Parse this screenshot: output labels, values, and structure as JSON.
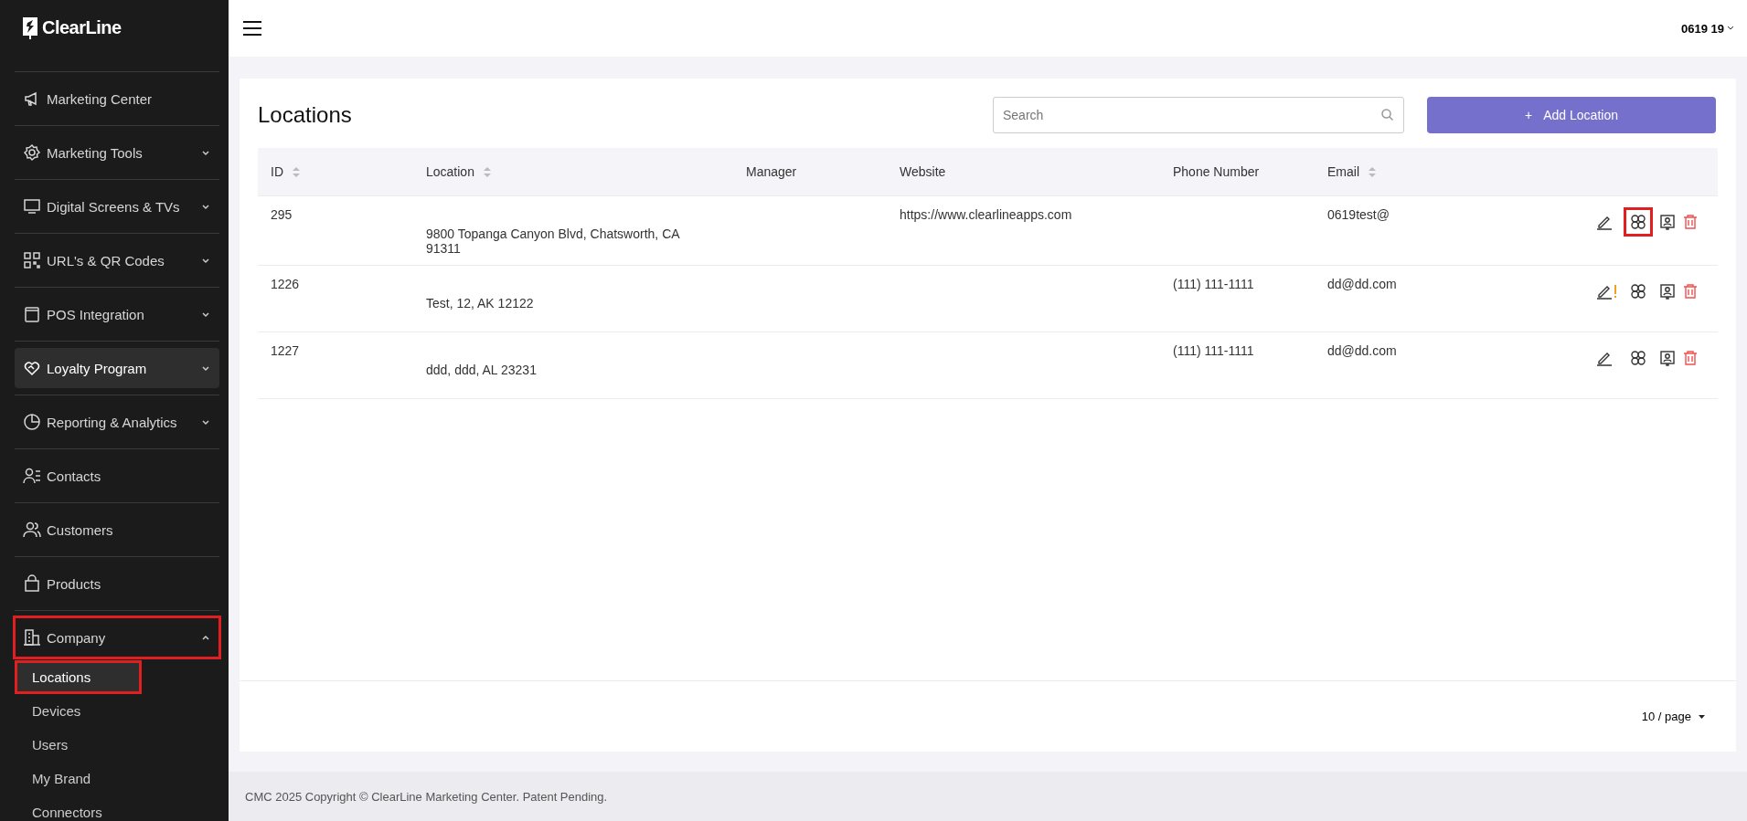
{
  "brand": {
    "name": "ClearLine"
  },
  "sidebar": {
    "items": [
      {
        "label": "Marketing Center",
        "kind": "link",
        "selected": false,
        "highlighted": false
      },
      {
        "label": "Marketing Tools",
        "kind": "menu",
        "expanded": false,
        "selected": false,
        "highlighted": false
      },
      {
        "label": "Digital Screens & TVs",
        "kind": "menu",
        "expanded": false,
        "selected": false,
        "highlighted": false
      },
      {
        "label": "URL's & QR Codes",
        "kind": "menu",
        "expanded": false,
        "selected": false,
        "highlighted": false
      },
      {
        "label": "POS Integration",
        "kind": "menu",
        "expanded": false,
        "selected": false,
        "highlighted": false
      },
      {
        "label": "Loyalty Program",
        "kind": "menu",
        "expanded": false,
        "selected": true,
        "highlighted": false
      },
      {
        "label": "Reporting & Analytics",
        "kind": "menu",
        "expanded": false,
        "selected": false,
        "highlighted": false
      },
      {
        "label": "Contacts",
        "kind": "link",
        "selected": false,
        "highlighted": false
      },
      {
        "label": "Customers",
        "kind": "link",
        "selected": false,
        "highlighted": false
      },
      {
        "label": "Products",
        "kind": "link",
        "selected": false,
        "highlighted": false
      },
      {
        "label": "Company",
        "kind": "menu",
        "expanded": true,
        "selected": false,
        "highlighted": true,
        "children": [
          {
            "label": "Locations",
            "selected": true,
            "highlighted": true
          },
          {
            "label": "Devices",
            "selected": false,
            "highlighted": false
          },
          {
            "label": "Users",
            "selected": false,
            "highlighted": false
          },
          {
            "label": "My Brand",
            "selected": false,
            "highlighted": false
          },
          {
            "label": "Connectors",
            "selected": false,
            "highlighted": false
          }
        ]
      }
    ]
  },
  "header": {
    "user": "0619 19"
  },
  "page": {
    "title": "Locations",
    "search": {
      "placeholder": "Search"
    },
    "add_button": {
      "icon": "+",
      "label": "Add Location"
    }
  },
  "table": {
    "columns": [
      {
        "label": "ID",
        "sortable": true
      },
      {
        "label": "Location",
        "sortable": true
      },
      {
        "label": "Manager",
        "sortable": false
      },
      {
        "label": "Website",
        "sortable": false
      },
      {
        "label": "Phone Number",
        "sortable": false
      },
      {
        "label": "Email",
        "sortable": true
      }
    ],
    "rows": [
      {
        "id": "295",
        "location": "9800 Topanga Canyon Blvd, Chatsworth, CA 91311",
        "website": "https://www.clearlineapps.com",
        "email": "0619test@",
        "warning": false,
        "grid_highlighted": true
      },
      {
        "id": "1226",
        "location": "Test, 12, AK 12122",
        "phone": "(111) 111-1111",
        "email": "dd@dd.com",
        "warning": true,
        "grid_highlighted": false
      },
      {
        "id": "1227",
        "location": "ddd, ddd, AL 23231",
        "phone": "(111) 111-1111",
        "email": "dd@dd.com",
        "warning": false,
        "grid_highlighted": false
      }
    ]
  },
  "pagination": {
    "page_size": "10 / page"
  },
  "footer": {
    "text": "CMC 2025 Copyright © ClearLine Marketing Center. Patent Pending."
  }
}
